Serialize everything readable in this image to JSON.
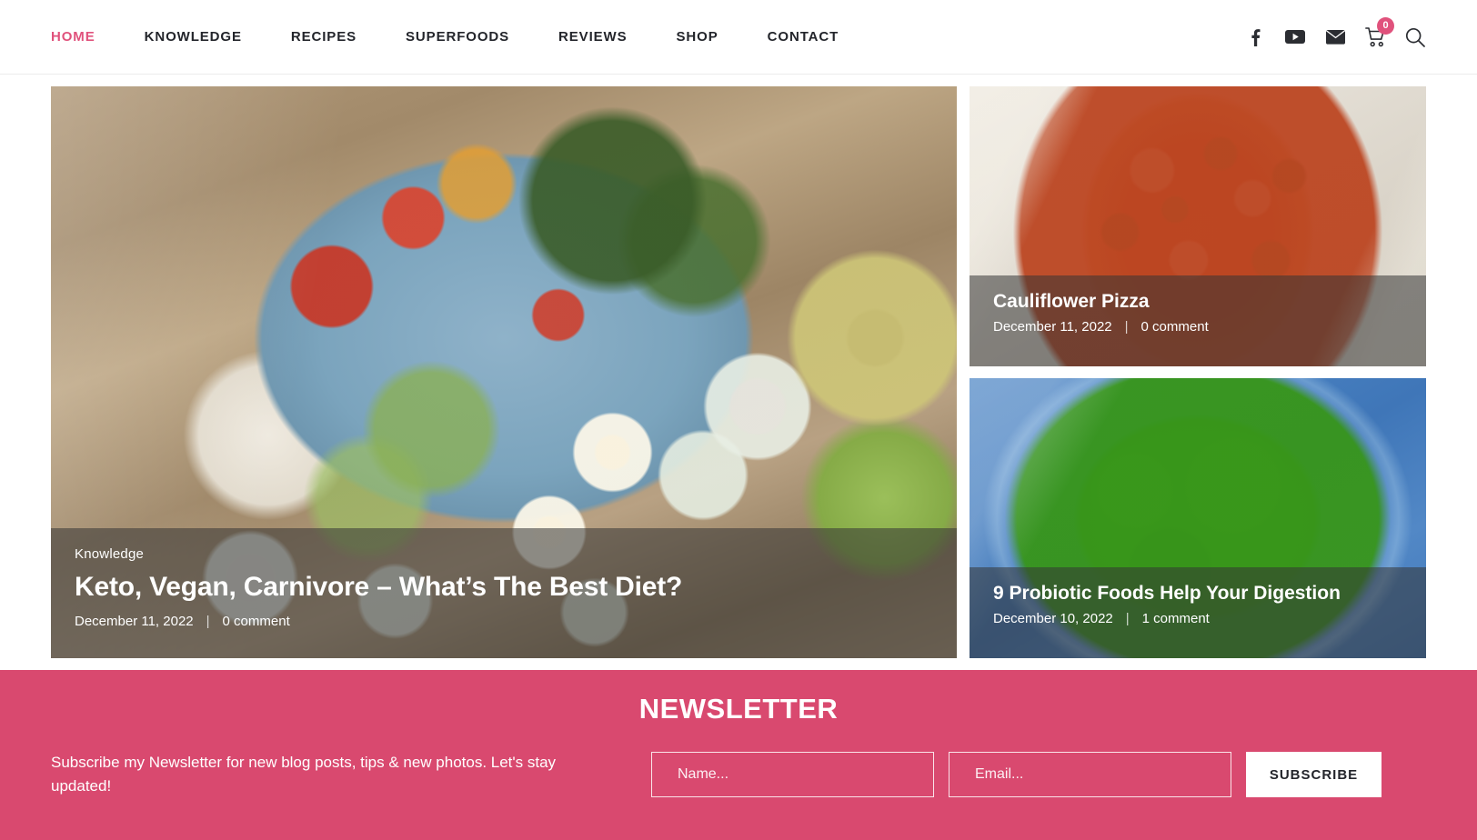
{
  "header": {
    "nav": [
      {
        "label": "HOME",
        "active": true
      },
      {
        "label": "KNOWLEDGE",
        "active": false
      },
      {
        "label": "RECIPES",
        "active": false
      },
      {
        "label": "SUPERFOODS",
        "active": false
      },
      {
        "label": "REVIEWS",
        "active": false
      },
      {
        "label": "SHOP",
        "active": false
      },
      {
        "label": "CONTACT",
        "active": false
      }
    ],
    "icons": [
      {
        "name": "facebook-icon"
      },
      {
        "name": "youtube-icon"
      },
      {
        "name": "email-icon"
      },
      {
        "name": "cart-icon"
      },
      {
        "name": "search-icon"
      }
    ],
    "cart_count": "0",
    "accent_color": "#e0527c"
  },
  "featured": {
    "category": "Knowledge",
    "title": "Keto, Vegan, Carnivore – What’s The Best Diet?",
    "date": "December 11, 2022",
    "separator": "|",
    "comments": "0 comment",
    "image_alt": "salad-bowl-photo"
  },
  "side_posts": [
    {
      "title": "Cauliflower Pizza",
      "date": "December 11, 2022",
      "separator": "|",
      "comments": "0 comment",
      "image_alt": "cauliflower-pizza-photo"
    },
    {
      "title": "9 Probiotic Foods Help Your Digestion",
      "date": "December 10, 2022",
      "separator": "|",
      "comments": "1 comment",
      "image_alt": "green-smoothie-photo"
    }
  ],
  "newsletter": {
    "heading": "NEWSLETTER",
    "description": "Subscribe my Newsletter for new blog posts, tips & new photos. Let's stay updated!",
    "name_placeholder": "Name...",
    "email_placeholder": "Email...",
    "name_value": "",
    "email_value": "",
    "button_label": "SUBSCRIBE",
    "background_color": "#d9496f"
  }
}
